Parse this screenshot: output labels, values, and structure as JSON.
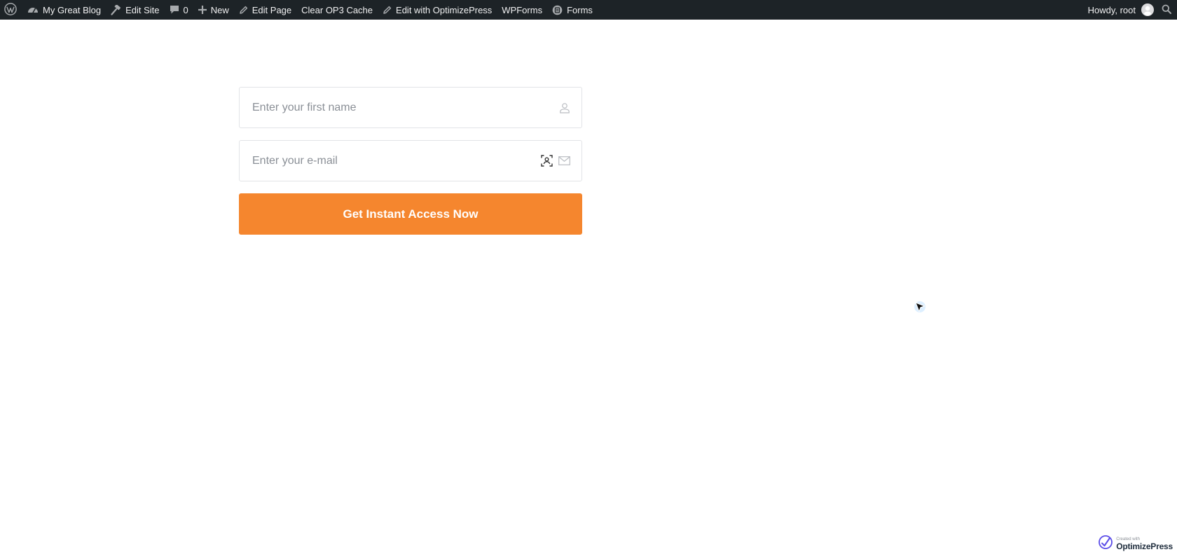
{
  "adminbar": {
    "site_name": "My Great Blog",
    "edit_site": "Edit Site",
    "comments_count": "0",
    "new_label": "New",
    "edit_page": "Edit Page",
    "clear_cache": "Clear OP3 Cache",
    "edit_with": "Edit with OptimizePress",
    "wpforms": "WPForms",
    "forms": "Forms",
    "howdy": "Howdy, root",
    "bg_color": "#1d2327"
  },
  "form": {
    "first_name_placeholder": "Enter your first name",
    "email_placeholder": "Enter your e-mail",
    "submit_label": "Get Instant Access Now",
    "button_color": "#f5862e"
  },
  "badge": {
    "small": "Created with",
    "brand": "OptimizePress"
  },
  "icons": {
    "wp": "wordpress-logo-icon",
    "dashboard": "dashboard-icon",
    "edit_site": "hammer-icon",
    "comments": "comment-icon",
    "new": "plus-icon",
    "edit_page": "pencil-icon",
    "edit_with": "pencil-icon",
    "forms": "forms-icon",
    "search": "search-icon",
    "user": "user-icon",
    "email": "envelope-icon",
    "contact": "contact-card-icon",
    "cursor": "mouse-cursor-icon"
  }
}
